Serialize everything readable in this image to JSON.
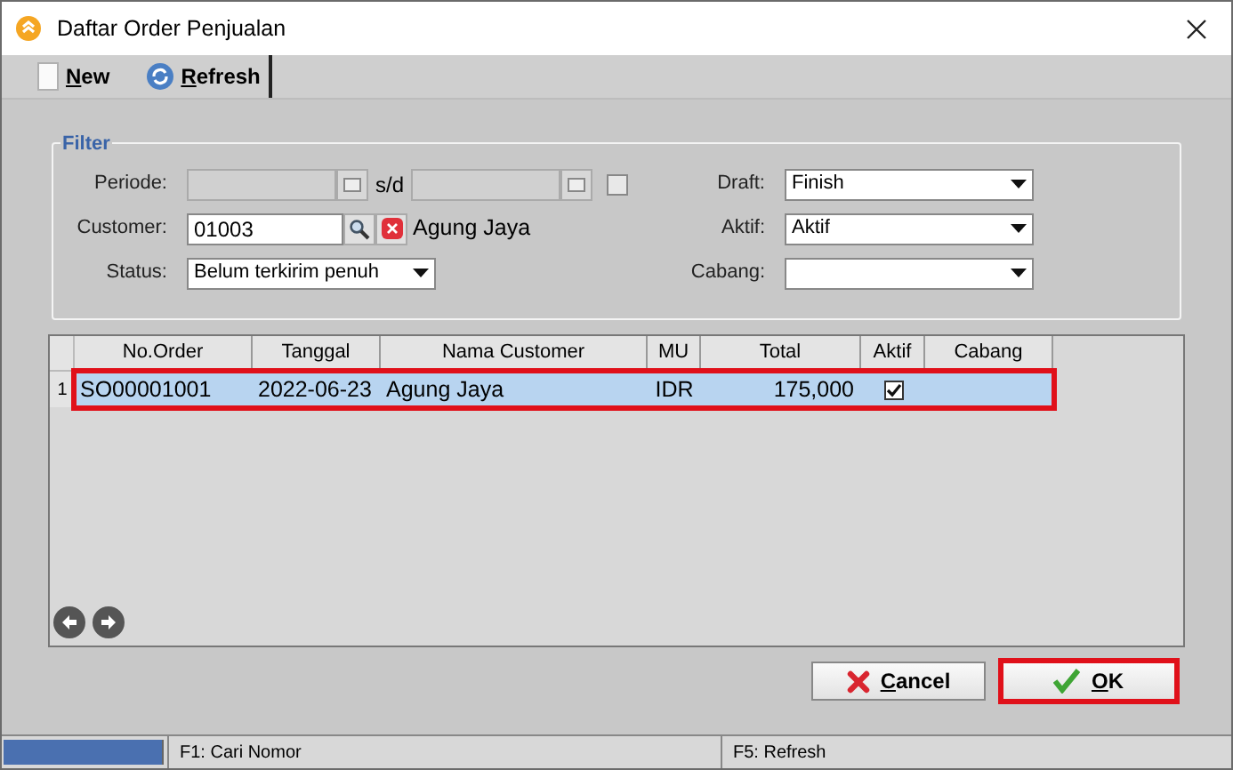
{
  "window": {
    "title": "Daftar Order Penjualan"
  },
  "toolbar": [
    {
      "label": "New",
      "kind": "new"
    },
    {
      "label": "Refresh",
      "kind": "refresh"
    }
  ],
  "filter": {
    "title": "Filter",
    "periode": {
      "label": "Periode:",
      "separator": "s/d",
      "checked": false
    },
    "customer": {
      "label": "Customer:",
      "value": "01003",
      "name": "Agung Jaya"
    },
    "status": {
      "label": "Status:",
      "value": "Belum terkirim penuh"
    },
    "draft": {
      "label": "Draft:",
      "value": "Finish"
    },
    "aktif": {
      "label": "Aktif:",
      "value": "Aktif"
    },
    "cabang": {
      "label": "Cabang:"
    }
  },
  "table": {
    "columns": [
      "No.Order",
      "Tanggal",
      "Nama Customer",
      "MU",
      "Total",
      "Aktif",
      "Cabang"
    ],
    "rows": [
      {
        "number": "1",
        "cells": [
          "SO00001001",
          "2022-06-23",
          "Agung Jaya",
          "IDR",
          "175,000"
        ],
        "aktif": true,
        "selected": true,
        "highlighted": true
      }
    ]
  },
  "buttons": [
    {
      "label": "Cancel",
      "kind": "cancel",
      "highlighted": false
    },
    {
      "label": "OK",
      "kind": "ok",
      "highlighted": true
    }
  ],
  "status_bar": [
    "F1: Cari Nomor",
    "F5: Refresh"
  ]
}
